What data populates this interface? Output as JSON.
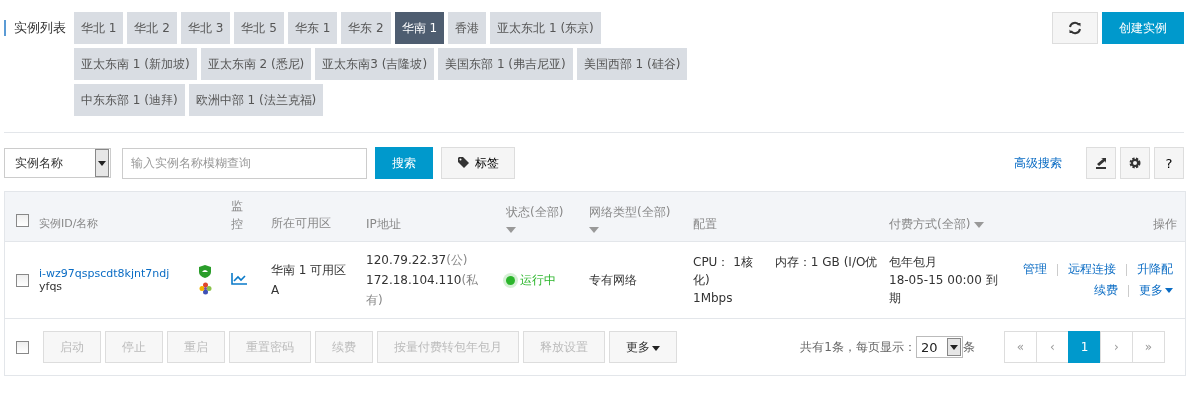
{
  "title": "实例列表",
  "region_tabs": [
    {
      "label": "华北 1",
      "selected": false
    },
    {
      "label": "华北 2",
      "selected": false
    },
    {
      "label": "华北 3",
      "selected": false
    },
    {
      "label": "华北 5",
      "selected": false
    },
    {
      "label": "华东 1",
      "selected": false
    },
    {
      "label": "华东 2",
      "selected": false
    },
    {
      "label": "华南 1",
      "selected": true
    },
    {
      "label": "香港",
      "selected": false
    },
    {
      "label": "亚太东北 1 (东京)",
      "selected": false
    },
    {
      "label": "亚太东南 1 (新加坡)",
      "selected": false
    },
    {
      "label": "亚太东南 2 (悉尼)",
      "selected": false
    },
    {
      "label": "亚太东南3 (吉隆坡)",
      "selected": false
    },
    {
      "label": "美国东部 1 (弗吉尼亚)",
      "selected": false
    },
    {
      "label": "美国西部 1 (硅谷)",
      "selected": false
    },
    {
      "label": "中东东部 1 (迪拜)",
      "selected": false
    },
    {
      "label": "欧洲中部 1 (法兰克福)",
      "selected": false
    }
  ],
  "create_button": "创建实例",
  "search": {
    "field_select": "实例名称",
    "placeholder": "输入实例名称模糊查询",
    "search_button": "搜索",
    "tag_button": "标签",
    "advanced_search": "高级搜索",
    "help_button": "?"
  },
  "table": {
    "header_checked": false,
    "columns": [
      {
        "label": "实例ID/名称",
        "filter": false
      },
      {
        "label": "监控",
        "filter": false
      },
      {
        "label": "所在可用区",
        "filter": false
      },
      {
        "label": "IP地址",
        "filter": false
      },
      {
        "label": "状态(全部)",
        "filter": true
      },
      {
        "label": "网络类型(全部)",
        "filter": true
      },
      {
        "label": "配置",
        "filter": false
      },
      {
        "label": "付费方式(全部)",
        "filter": true
      },
      {
        "label": "操作",
        "filter": false
      }
    ],
    "rows": [
      {
        "checked": false,
        "id": "i-wz97qspscdt8kjnt7ndj",
        "name": "yfqs",
        "zone": "华南 1 可用区 A",
        "ip_public": "120.79.22.37",
        "ip_public_tag": "(公)",
        "ip_private": "172.18.104.110",
        "ip_private_tag": "(私有)",
        "status": "运行中",
        "network": "专有网络",
        "cpu": "CPU： 1核",
        "memory": "内存：1 GB (I/O优化)",
        "bandwidth": "1Mbps",
        "billing": "包年包月",
        "expiry": "18-05-15 00:00 到期",
        "actions": [
          {
            "label": "管理",
            "kind": "link"
          },
          {
            "label": "远程连接",
            "kind": "link"
          },
          {
            "label": "升降配",
            "kind": "link"
          },
          {
            "label": "续费",
            "kind": "link"
          },
          {
            "label": "更多",
            "kind": "menu"
          }
        ]
      }
    ]
  },
  "footer": {
    "select_all_checked": false,
    "bulk_buttons": [
      {
        "label": "启动",
        "disabled": true,
        "kind": "button"
      },
      {
        "label": "停止",
        "disabled": true,
        "kind": "button"
      },
      {
        "label": "重启",
        "disabled": true,
        "kind": "button"
      },
      {
        "label": "重置密码",
        "disabled": true,
        "kind": "button"
      },
      {
        "label": "续费",
        "disabled": true,
        "kind": "button"
      },
      {
        "label": "按量付费转包年包月",
        "disabled": true,
        "kind": "button"
      },
      {
        "label": "释放设置",
        "disabled": true,
        "kind": "button"
      },
      {
        "label": "更多",
        "disabled": false,
        "kind": "menu"
      }
    ],
    "total": "共有1条，",
    "per_page_label": "每页显示：",
    "page_size": "20",
    "per_page_unit": "条",
    "pages": [
      {
        "label": "«",
        "selected": false
      },
      {
        "label": "‹",
        "selected": false
      },
      {
        "label": "1",
        "selected": true
      },
      {
        "label": "›",
        "selected": false
      },
      {
        "label": "»",
        "selected": false
      }
    ]
  }
}
